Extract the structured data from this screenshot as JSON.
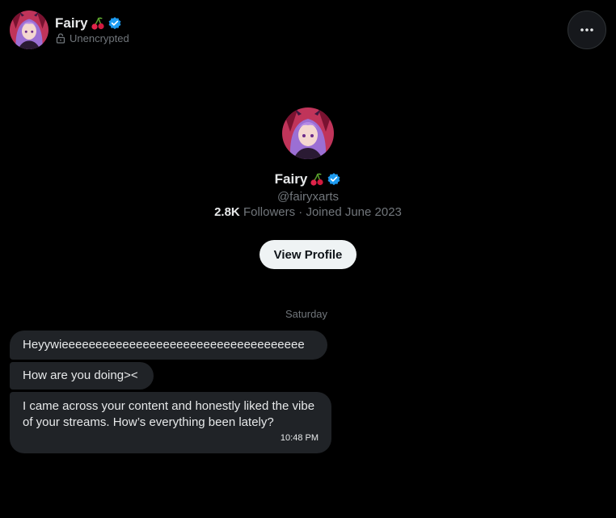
{
  "header": {
    "name": "Fairy",
    "encryption_status": "Unencrypted",
    "more_label": "More"
  },
  "profile": {
    "name": "Fairy",
    "handle": "@fairyxarts",
    "followers_count": "2.8K",
    "followers_label": "Followers",
    "joined": "· Joined June 2023",
    "view_profile_label": "View Profile"
  },
  "conversation": {
    "date_separator": "Saturday",
    "messages": [
      {
        "text": "Heyywieeeeeeeeeeeeeeeeeeeeeeeeeeeeeeeeeeee"
      },
      {
        "text": "How are you doing><"
      },
      {
        "text": "I came across your content and honestly liked the vibe of your streams. How’s everything been lately?",
        "time": "10:48 PM"
      }
    ]
  },
  "colors": {
    "background": "#000000",
    "bubble": "#202327",
    "secondary_text": "#71767b",
    "verified": "#1d9bf0"
  },
  "icons": [
    "cherry-icon",
    "verified-badge-icon",
    "lock-icon",
    "more-dots-icon"
  ]
}
